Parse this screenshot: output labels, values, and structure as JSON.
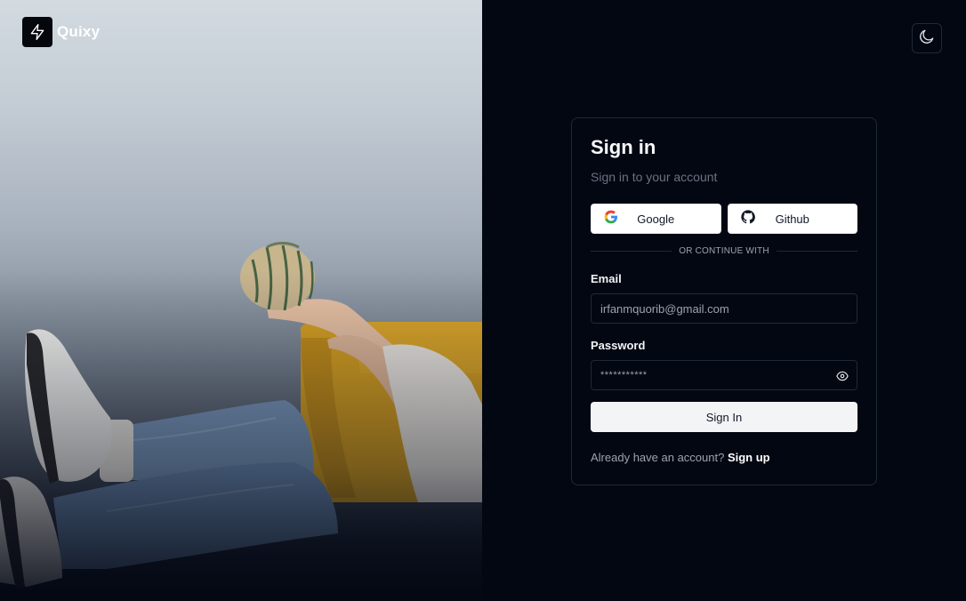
{
  "brand": {
    "name": "Quixy",
    "logo_icon": "lightning-bolt-icon"
  },
  "theme_toggle": {
    "icon": "moon-icon"
  },
  "hero": {
    "image": "person-on-yellow-chair-holding-pumpkin"
  },
  "signin": {
    "title": "Sign in",
    "subtitle": "Sign in to your account",
    "social": [
      {
        "label": "Google",
        "icon": "google-icon"
      },
      {
        "label": "Github",
        "icon": "github-icon"
      }
    ],
    "divider_text": "OR CONTINUE WITH",
    "email": {
      "label": "Email",
      "value": "irfanmquorib@gmail.com"
    },
    "password": {
      "label": "Password",
      "masked_value": "***********",
      "toggle_icon": "eye-icon"
    },
    "submit_label": "Sign In",
    "footer": {
      "prompt": "Already have an account?",
      "link": "Sign up"
    }
  },
  "colors": {
    "background": "#030712",
    "border": "#1f2937",
    "button_light": "#f3f4f6",
    "muted_text": "#9ca3af"
  }
}
